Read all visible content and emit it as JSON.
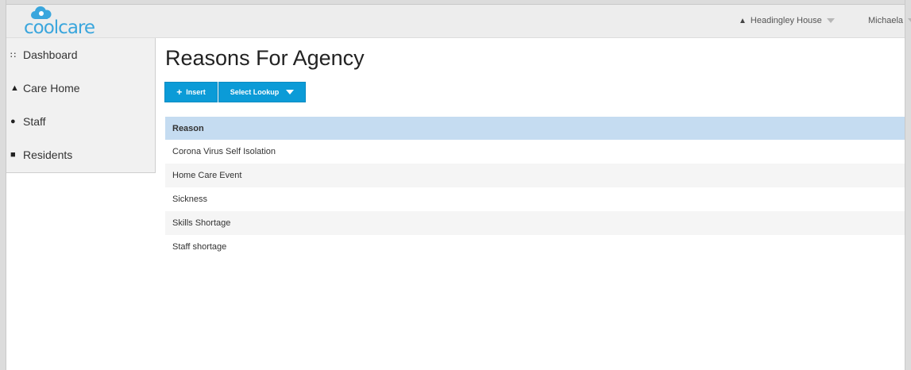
{
  "brand": {
    "name": "coolcare",
    "accent_color": "#3aa6dd"
  },
  "topbar": {
    "home_icon": "home-icon",
    "home_name": "Headingley House",
    "user_name": "Michaela"
  },
  "sidebar": {
    "items": [
      {
        "label": "Dashboard",
        "icon": "grid-icon"
      },
      {
        "label": "Care Home",
        "icon": "home-icon"
      },
      {
        "label": "Staff",
        "icon": "users-icon"
      },
      {
        "label": "Residents",
        "icon": "id-card-icon"
      }
    ]
  },
  "page": {
    "title": "Reasons For Agency"
  },
  "toolbar": {
    "insert_label": "Insert",
    "lookup_label": "Select Lookup",
    "button_color": "#0b9bd7"
  },
  "grid": {
    "columns": [
      "Reason"
    ],
    "header_color": "#c5dcf1",
    "rows": [
      "Corona Virus Self Isolation",
      "Home Care Event",
      "Sickness",
      "Skills Shortage",
      "Staff shortage"
    ]
  }
}
